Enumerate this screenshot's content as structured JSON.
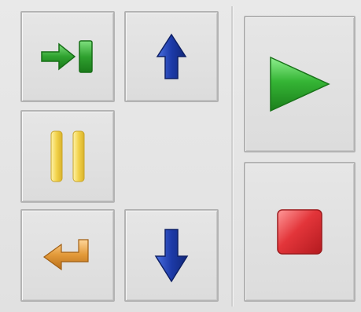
{
  "toolbar": {
    "buttons": [
      {
        "id": "step-into",
        "icon": "step-into-icon",
        "color": "#2fa12f"
      },
      {
        "id": "move-up",
        "icon": "arrow-up-icon",
        "color": "#1c3aa8"
      },
      {
        "id": "pause",
        "icon": "pause-icon",
        "color": "#f2d24a"
      },
      {
        "id": "return",
        "icon": "return-arrow-icon",
        "color": "#e39a3a"
      },
      {
        "id": "move-down",
        "icon": "arrow-down-icon",
        "color": "#1c3aa8"
      },
      {
        "id": "play",
        "icon": "play-icon",
        "color": "#2fae2f"
      },
      {
        "id": "stop",
        "icon": "stop-icon",
        "color": "#d8262a"
      }
    ]
  }
}
